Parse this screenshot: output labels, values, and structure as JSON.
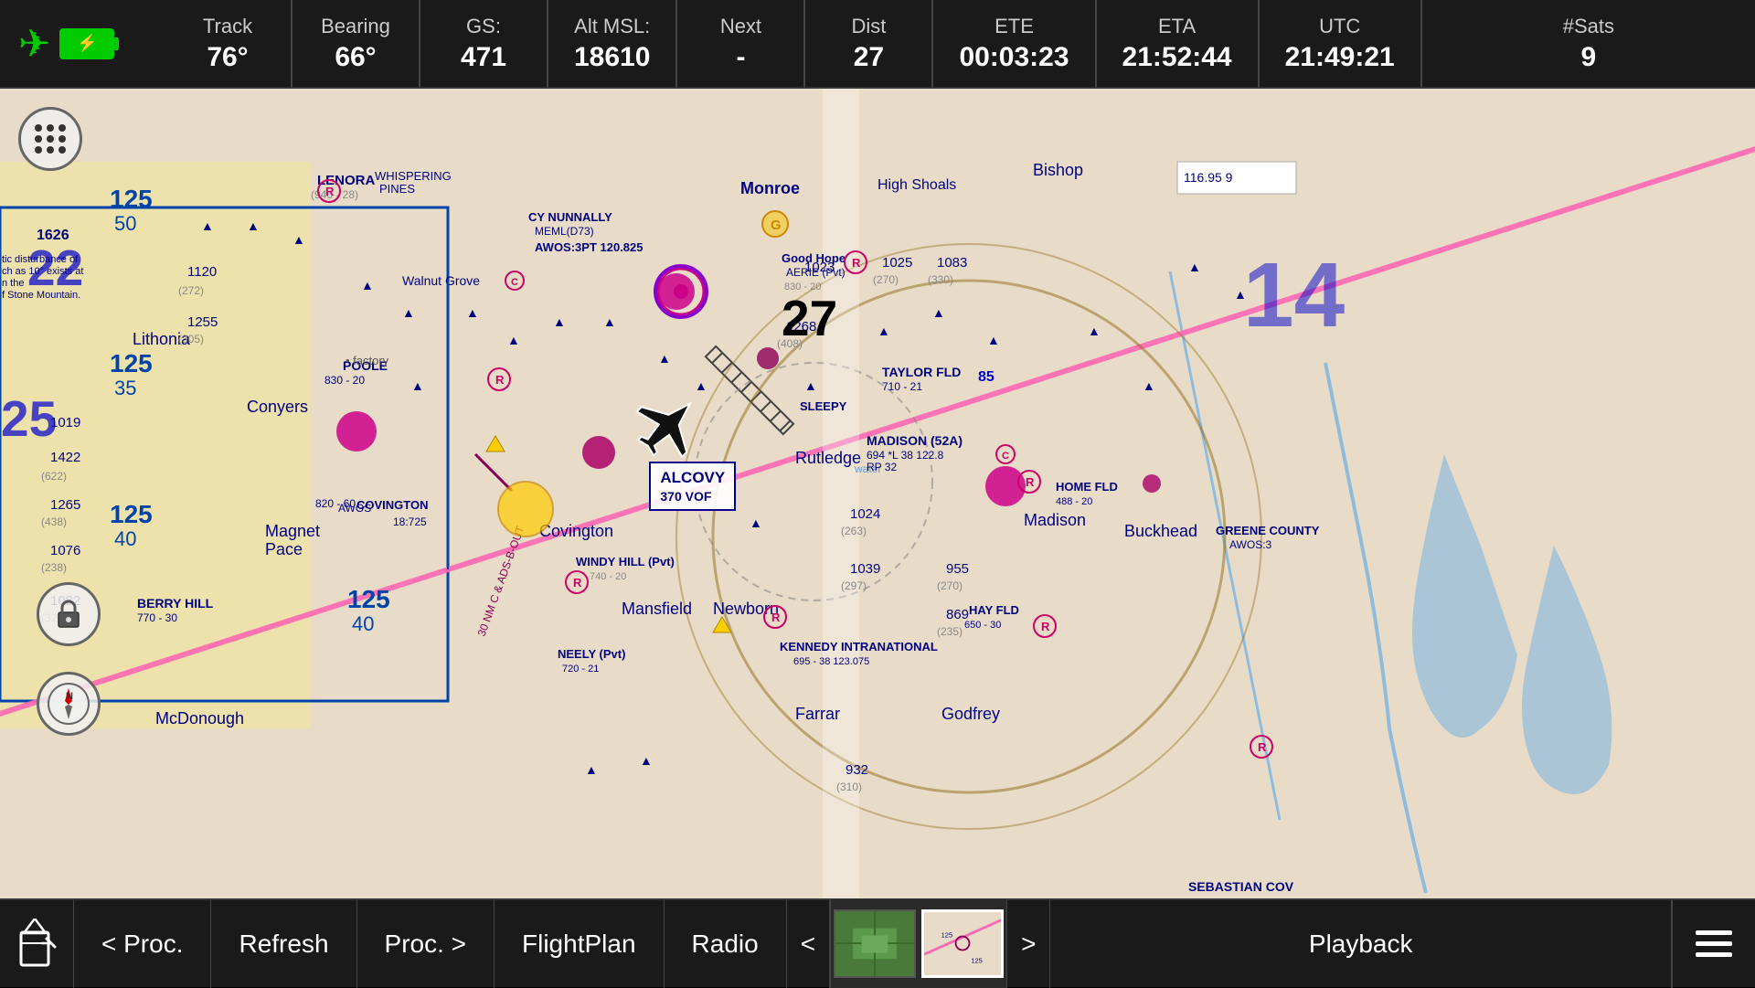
{
  "header": {
    "track_label": "Track",
    "track_value": "76°",
    "bearing_label": "Bearing",
    "bearing_value": "66°",
    "gs_label": "GS:",
    "gs_value": "471",
    "alt_msl_label": "Alt MSL:",
    "alt_msl_value": "18610",
    "next_label": "Next",
    "next_value": "-",
    "dist_label": "Dist",
    "dist_value": "27",
    "ete_label": "ETE",
    "ete_value": "00:03:23",
    "eta_label": "ETA",
    "eta_value": "21:52:44",
    "utc_label": "UTC",
    "utc_value": "21:49:21",
    "sats_label": "#Sats",
    "sats_value": "9"
  },
  "bottom_bar": {
    "proc_prev_label": "< Proc.",
    "refresh_label": "Refresh",
    "proc_next_label": "Proc. >",
    "flightplan_label": "FlightPlan",
    "radio_label": "Radio",
    "arrow_left_label": "<",
    "arrow_right_label": ">",
    "playback_label": "Playback"
  },
  "map": {
    "alcovy_label": "ALCOVY",
    "alcovy_freq": "370  VOF"
  },
  "controls": {
    "compass_label": "N"
  }
}
